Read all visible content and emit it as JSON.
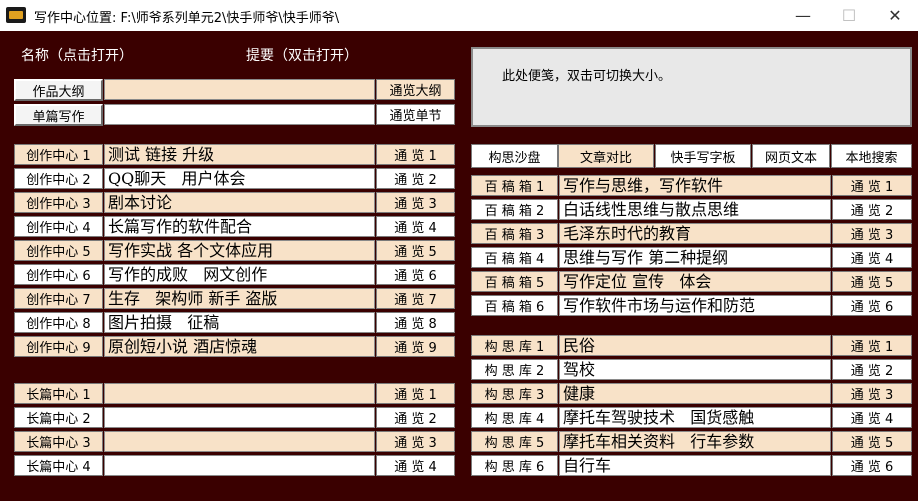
{
  "window": {
    "title": "写作中心位置:  F:\\师爷系列单元2\\快手师爷\\快手师爷\\",
    "minimize": "—",
    "maximize": "☐",
    "close": "✕"
  },
  "headers": {
    "name": "名称（点击打开）",
    "summary": "提要（双击打开）"
  },
  "top_rows": [
    {
      "label": "作品大纲",
      "value": "",
      "browse": "通览大纲"
    },
    {
      "label": "单篇写作",
      "value": "",
      "browse": "通览单节"
    }
  ],
  "creation_center": [
    {
      "label": "创作中心 1",
      "value": "测试 链接 升级",
      "browse": "通 览 1"
    },
    {
      "label": "创作中心 2",
      "value": "QQ聊天   用户体会",
      "browse": "通 览 2"
    },
    {
      "label": "创作中心 3",
      "value": "剧本讨论",
      "browse": "通 览 3"
    },
    {
      "label": "创作中心 4",
      "value": "长篇写作的软件配合",
      "browse": "通 览 4"
    },
    {
      "label": "创作中心 5",
      "value": "写作实战 各个文体应用",
      "browse": "通 览 5"
    },
    {
      "label": "创作中心 6",
      "value": "写作的成败   网文创作",
      "browse": "通 览 6"
    },
    {
      "label": "创作中心 7",
      "value": "生存   架构师 新手 盗版",
      "browse": "通 览 7"
    },
    {
      "label": "创作中心 8",
      "value": "图片拍摄   征稿",
      "browse": "通 览 8"
    },
    {
      "label": "创作中心 9",
      "value": "原创短小说 酒店惊魂",
      "browse": "通 览 9"
    }
  ],
  "long_center": [
    {
      "label": "长篇中心 1",
      "value": "",
      "browse": "通 览 1"
    },
    {
      "label": "长篇中心 2",
      "value": "",
      "browse": "通 览 2"
    },
    {
      "label": "长篇中心 3",
      "value": "",
      "browse": "通 览 3"
    },
    {
      "label": "长篇中心 4",
      "value": "",
      "browse": "通 览 4"
    }
  ],
  "notes": {
    "text": "此处便笺，双击可切换大小。"
  },
  "tabs": [
    "构思沙盘",
    "文章对比",
    "快手写字板",
    "网页文本",
    "本地搜索"
  ],
  "draft_box": [
    {
      "label": "百 稿 箱 1",
      "value": "写作与思维，写作软件",
      "browse": "通 览 1"
    },
    {
      "label": "百 稿 箱 2",
      "value": "白话线性思维与散点思维",
      "browse": "通 览 2"
    },
    {
      "label": "百 稿 箱 3",
      "value": "毛泽东时代的教育",
      "browse": "通 览 3"
    },
    {
      "label": "百 稿 箱 4",
      "value": "思维与写作 第二种提纲",
      "browse": "通 览 4"
    },
    {
      "label": "百 稿 箱 5",
      "value": "写作定位 宣传   体会",
      "browse": "通 览 5"
    },
    {
      "label": "百 稿 箱 6",
      "value": "写作软件市场与运作和防范",
      "browse": "通 览 6"
    }
  ],
  "idea_bank": [
    {
      "label": "构 思 库 1",
      "value": "民俗",
      "browse": "通 览 1"
    },
    {
      "label": "构 思 库 2",
      "value": "驾校",
      "browse": "通 览 2"
    },
    {
      "label": "构 思 库 3",
      "value": "健康",
      "browse": "通 览 3"
    },
    {
      "label": "构 思 库 4",
      "value": "摩托车驾驶技术   国货感触",
      "browse": "通 览 4"
    },
    {
      "label": "构 思 库 5",
      "value": "摩托车相关资料   行车参数",
      "browse": "通 览 5"
    },
    {
      "label": "构 思 库 6",
      "value": "自行车",
      "browse": "通 览 6"
    }
  ],
  "colors": {
    "background": "#3a0000",
    "tan": "#f8e2c8",
    "white": "#ffffff"
  }
}
